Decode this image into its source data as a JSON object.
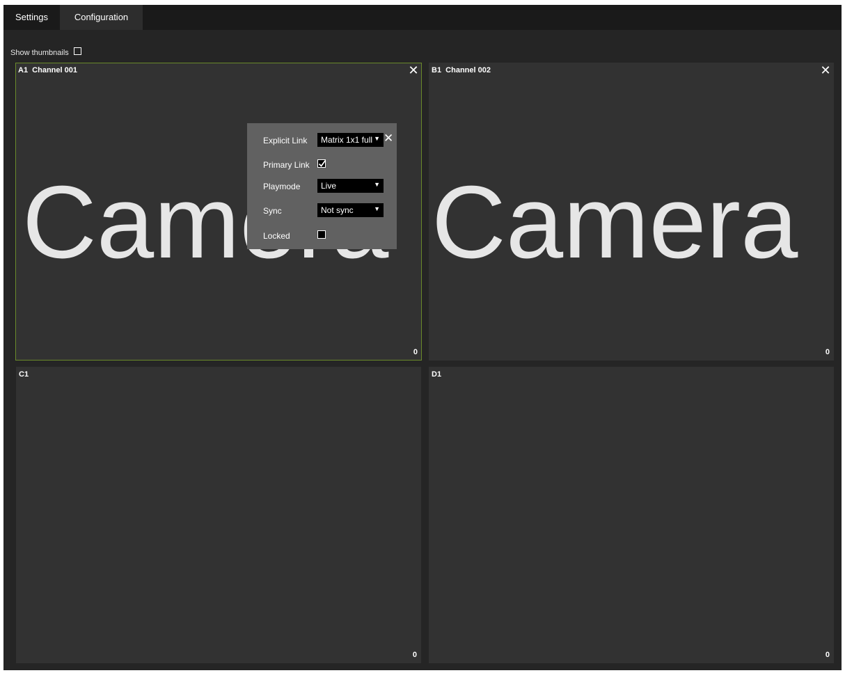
{
  "tabs": [
    {
      "label": "Settings",
      "active": false
    },
    {
      "label": "Configuration",
      "active": true
    }
  ],
  "show_thumbnails": {
    "label": "Show thumbnails",
    "checked": false
  },
  "cells": [
    {
      "title": "A1  Channel 001",
      "count": "0",
      "watermark": "Camera",
      "closable": true,
      "selected": true
    },
    {
      "title": "B1  Channel 002",
      "count": "0",
      "watermark": "Camera",
      "closable": true,
      "selected": false
    },
    {
      "title": "C1",
      "count": "0",
      "watermark": "",
      "closable": false,
      "selected": false
    },
    {
      "title": "D1",
      "count": "0",
      "watermark": "",
      "closable": false,
      "selected": false
    }
  ],
  "link_popup": {
    "explicit_link": {
      "label": "Explicit Link",
      "value": "Matrix 1x1 full"
    },
    "primary_link": {
      "label": "Primary Link",
      "checked": true
    },
    "playmode": {
      "label": "Playmode",
      "value": "Live"
    },
    "sync": {
      "label": "Sync",
      "value": "Not sync"
    },
    "locked": {
      "label": "Locked",
      "checked": false
    }
  },
  "icons": {
    "close": "close-icon",
    "dropdown": "chevron-down-icon",
    "check": "checkmark-icon"
  },
  "colors": {
    "background": "#252525",
    "cell": "#323232",
    "selected_border": "#6a8a2a",
    "popup": "#616161",
    "tabbar": "#1a1a1a"
  }
}
